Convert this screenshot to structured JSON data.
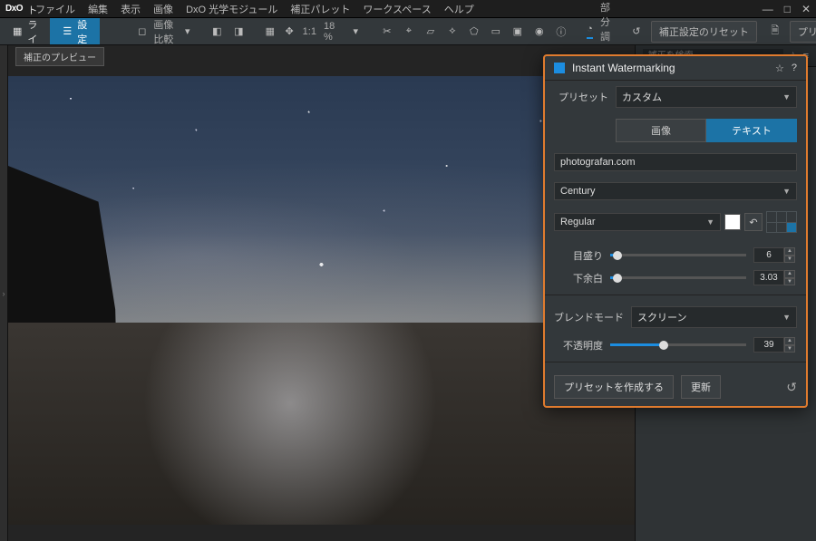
{
  "app": {
    "logo": "DxO"
  },
  "menus": [
    "ファイル",
    "編集",
    "表示",
    "画像",
    "DxO 光学モジュール",
    "補正パレット",
    "ワークスペース",
    "ヘルプ"
  ],
  "windowControls": {
    "min": "—",
    "max": "□",
    "close": "✕"
  },
  "modes": {
    "library": "フォトライブラリ",
    "settings": "設定"
  },
  "toolbar": {
    "compare": "画像比較",
    "ratio": "1:1",
    "zoom": "18 %",
    "localAdjust": "部分調整",
    "resetCorrections": "補正設定のリセット",
    "applyPreset": "プリセット適用"
  },
  "viewerTag": "補正のプレビュー",
  "watermarkText": "photografan.com",
  "sidebar": {
    "searchPlaceholder": "補正を検索..."
  },
  "panel": {
    "title": "Instant Watermarking",
    "presetLabel": "プリセット",
    "presetValue": "カスタム",
    "tabImage": "画像",
    "tabText": "テキスト",
    "textValue": "photografan.com",
    "fontFamily": "Century",
    "fontStyle": "Regular",
    "scaleLabel": "目盛り",
    "scaleValue": "6",
    "marginLabel": "下余白",
    "marginValue": "3.03",
    "blendLabel": "ブレンドモード",
    "blendValue": "スクリーン",
    "opacityLabel": "不透明度",
    "opacityValue": "39",
    "createPreset": "プリセットを作成する",
    "update": "更新"
  },
  "sliderPercents": {
    "scale": 5,
    "margin": 5,
    "opacity": 39
  }
}
